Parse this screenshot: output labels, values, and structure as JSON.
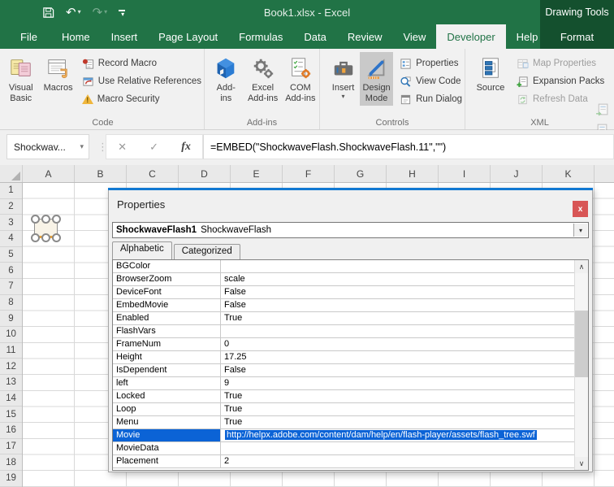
{
  "colors": {
    "excel_green": "#217346",
    "contextual_dark_green": "#14502e",
    "ribbon_bg": "#f1f1f1",
    "active_button_gray": "#c9c9c9",
    "selection_blue": "#0b63d6",
    "props_top_accent_blue": "#1279d2",
    "close_button_red": "#d85555",
    "warning_yellow": "#f0b63c",
    "addin_cube_blue": "#2b7cd3"
  },
  "icons": {
    "dropdown": "▾",
    "ellipsis_v": "⋮",
    "cancel": "✕",
    "check": "✓",
    "fx": "fx",
    "undo": "↶",
    "redo": "↷",
    "scroll_up": "∧",
    "scroll_down": "∨",
    "close": "x",
    "warning": "!"
  },
  "titlebar": {
    "title": "Book1.xlsx  -  Excel",
    "contextual": "Drawing Tools"
  },
  "tabs": [
    {
      "label": "File",
      "file": true
    },
    {
      "label": "Home"
    },
    {
      "label": "Insert"
    },
    {
      "label": "Page Layout"
    },
    {
      "label": "Formulas"
    },
    {
      "label": "Data"
    },
    {
      "label": "Review"
    },
    {
      "label": "View"
    },
    {
      "label": "Developer",
      "active": true
    },
    {
      "label": "Help"
    }
  ],
  "contextual_tab": "Format",
  "ribbon": {
    "code": {
      "label": "Code",
      "visual_basic": "Visual\nBasic",
      "macros": "Macros",
      "record_macro": "Record Macro",
      "use_relative_references": "Use Relative References",
      "macro_security": "Macro Security"
    },
    "addins": {
      "label": "Add-ins",
      "add_ins": "Add-\nins",
      "excel_addins": "Excel\nAdd-ins",
      "com_addins": "COM\nAdd-ins"
    },
    "controls": {
      "label": "Controls",
      "insert": "Insert",
      "design_mode": "Design\nMode",
      "properties": "Properties",
      "view_code": "View Code",
      "run_dialog": "Run Dialog"
    },
    "xml": {
      "label": "XML",
      "source": "Source",
      "map_properties": "Map Properties",
      "expansion_packs": "Expansion Packs",
      "refresh_data": "Refresh Data"
    }
  },
  "formula_bar": {
    "name_box": "Shockwav...",
    "formula": "=EMBED(\"ShockwaveFlash.ShockwaveFlash.11\",\"\")"
  },
  "sheet": {
    "columns": [
      "A",
      "B",
      "C",
      "D",
      "E",
      "F",
      "G",
      "H",
      "I",
      "J",
      "K"
    ],
    "rows": [
      "1",
      "2",
      "3",
      "4",
      "5",
      "6",
      "7",
      "8",
      "9",
      "10",
      "11",
      "12",
      "13",
      "14",
      "15",
      "16",
      "17",
      "18",
      "19"
    ]
  },
  "properties_window": {
    "title": "Properties",
    "object_name": "ShockwaveFlash1",
    "object_type": "ShockwaveFlash",
    "tabs": [
      {
        "label": "Alphabetic",
        "active": true
      },
      {
        "label": "Categorized"
      }
    ],
    "properties": [
      {
        "name": "BGColor",
        "value": ""
      },
      {
        "name": "BrowserZoom",
        "value": "scale"
      },
      {
        "name": "DeviceFont",
        "value": "False"
      },
      {
        "name": "EmbedMovie",
        "value": "False"
      },
      {
        "name": "Enabled",
        "value": "True"
      },
      {
        "name": "FlashVars",
        "value": ""
      },
      {
        "name": "FrameNum",
        "value": "0"
      },
      {
        "name": "Height",
        "value": "17.25"
      },
      {
        "name": "IsDependent",
        "value": "False"
      },
      {
        "name": "left",
        "value": "9"
      },
      {
        "name": "Locked",
        "value": "True"
      },
      {
        "name": "Loop",
        "value": "True"
      },
      {
        "name": "Menu",
        "value": "True"
      },
      {
        "name": "Movie",
        "value": "http://helpx.adobe.com/content/dam/help/en/flash-player/assets/flash_tree.swf",
        "selected": true
      },
      {
        "name": "MovieData",
        "value": ""
      },
      {
        "name": "Placement",
        "value": "2"
      }
    ]
  }
}
